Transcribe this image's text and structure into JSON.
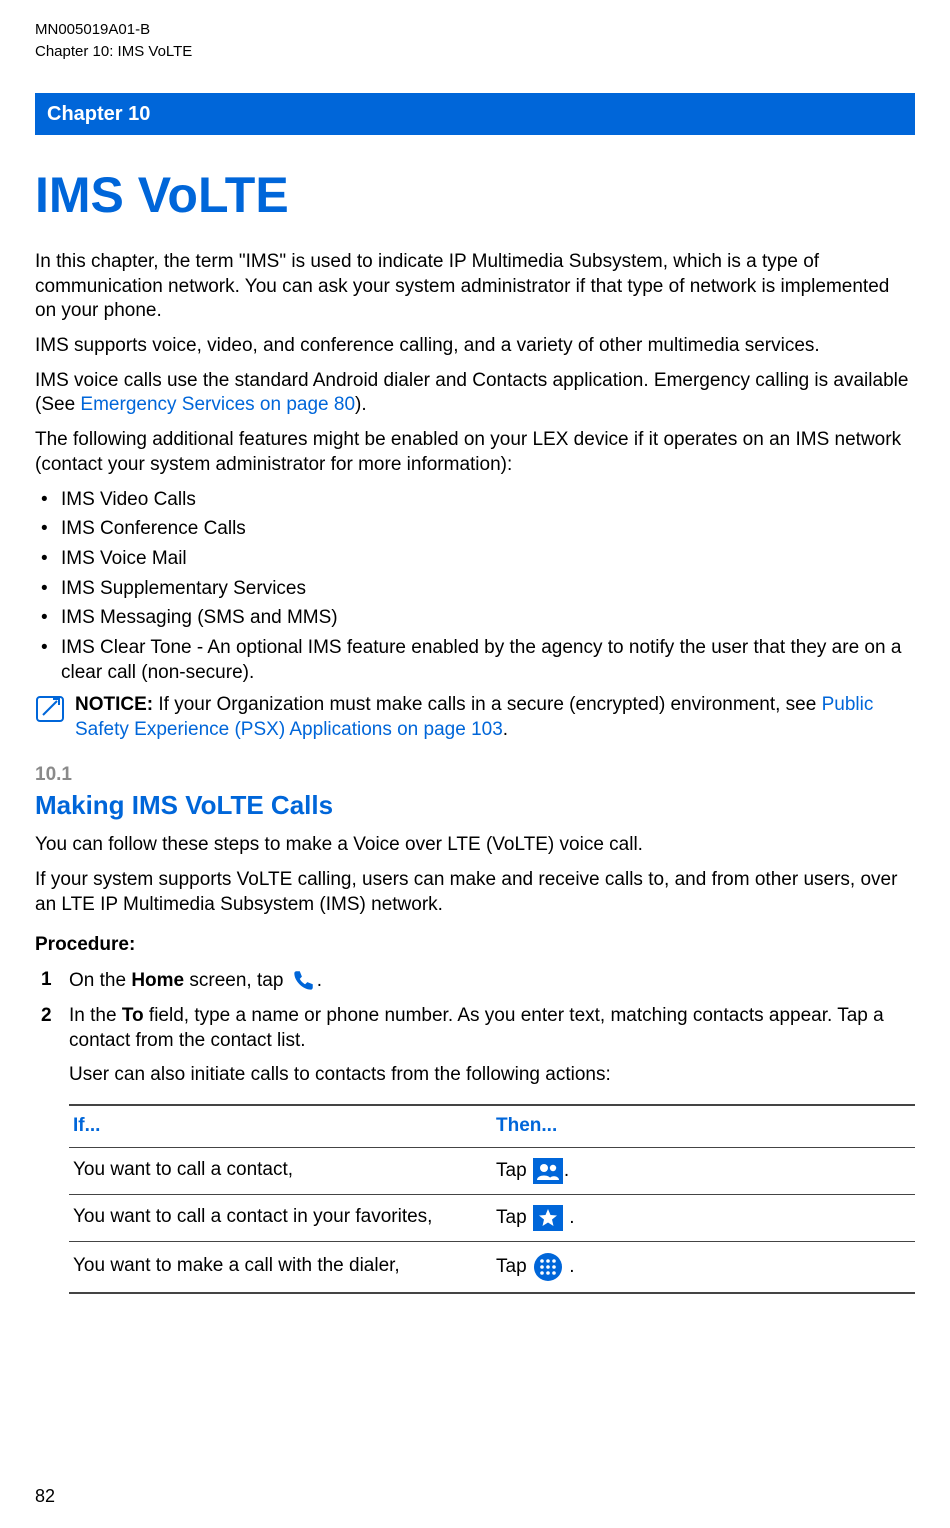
{
  "header": {
    "doc_id": "MN005019A01-B",
    "breadcrumb": "Chapter 10:  IMS VoLTE"
  },
  "chapter_bar": "Chapter 10",
  "chapter_title": "IMS VoLTE",
  "intro": {
    "p1": "In this chapter, the term \"IMS\" is used to indicate IP Multimedia Subsystem, which is a type of communication network. You can ask your system administrator if that type of network is implemented on your phone.",
    "p2": "IMS supports voice, video, and conference calling, and a variety of other multimedia services.",
    "p3a": "IMS voice calls use the standard Android dialer and Contacts application. Emergency calling is available (See ",
    "p3_link": "Emergency Services on page 80",
    "p3b": ").",
    "p4": "The following additional features might be enabled on your LEX device if it operates on an IMS network (contact your system administrator for more information):"
  },
  "features": [
    "IMS Video Calls",
    "IMS Conference Calls",
    "IMS Voice Mail",
    "IMS Supplementary Services",
    "IMS Messaging (SMS and MMS)",
    "IMS Clear Tone - An optional IMS feature enabled by the agency to notify the user that they are on a clear call (non-secure)."
  ],
  "notice": {
    "label": "NOTICE:",
    "text_a": " If your Organization must make calls in a secure (encrypted) environment, see ",
    "link": "Public Safety Experience (PSX) Applications on page 103",
    "text_b": "."
  },
  "section": {
    "num": "10.1",
    "title": "Making IMS VoLTE Calls",
    "p1": "You can follow these steps to make a Voice over LTE (VoLTE) voice call.",
    "p2": "If your system supports VoLTE calling, users can make and receive calls to, and from other users, over an LTE IP Multimedia Subsystem (IMS) network.",
    "proc_label": "Procedure:"
  },
  "steps": {
    "s1a": "On the ",
    "s1_bold": "Home",
    "s1b": " screen, tap ",
    "s1c": ".",
    "s2a": "In the ",
    "s2_bold": "To",
    "s2b": " field, type a name or phone number. As you enter text, matching contacts appear. Tap a contact from the contact list.",
    "s2_p2": "User can also initiate calls to contacts from the following actions:"
  },
  "table": {
    "h_if": "If...",
    "h_then": "Then...",
    "rows": [
      {
        "if": "You want to call a contact,",
        "then_a": "Tap ",
        "then_b": ".",
        "icon": "contacts"
      },
      {
        "if": "You want to call a contact in your favorites,",
        "then_a": "Tap ",
        "then_b": " .",
        "icon": "star"
      },
      {
        "if": "You want to make a call with the dialer,",
        "then_a": "Tap ",
        "then_b": " .",
        "icon": "dialpad"
      }
    ]
  },
  "page_number": "82",
  "icons": {
    "phone": "phone-icon",
    "contacts": "contacts-icon",
    "star": "star-icon",
    "dialpad": "dialpad-icon",
    "notice": "notice-icon"
  }
}
